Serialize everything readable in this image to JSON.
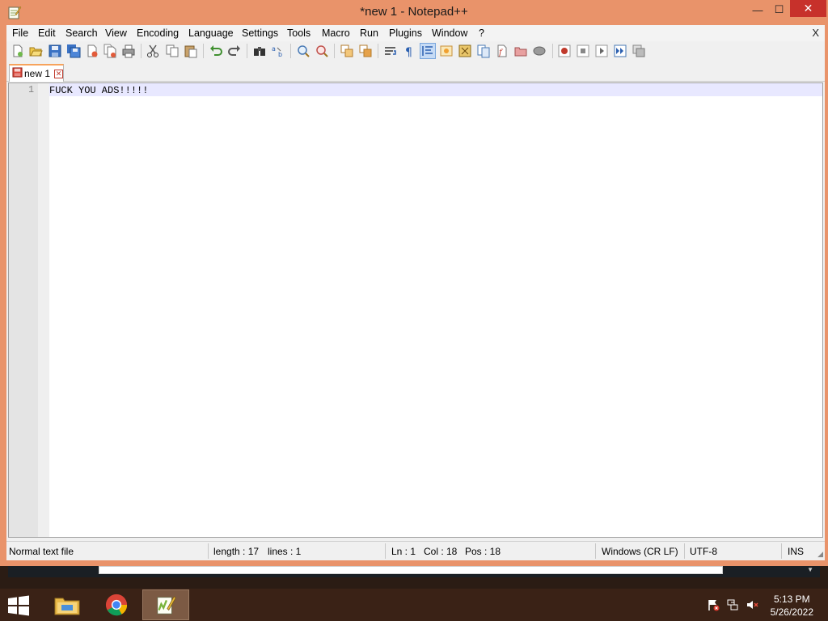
{
  "window": {
    "title": "*new 1 - Notepad++",
    "minimize_glyph": "—",
    "maximize_glyph": "☐",
    "close_glyph": "✕"
  },
  "menu": {
    "items": [
      "File",
      "Edit",
      "Search",
      "View",
      "Encoding",
      "Language",
      "Settings",
      "Tools",
      "Macro",
      "Run",
      "Plugins",
      "Window",
      "?"
    ],
    "close_label": "X"
  },
  "toolbar": {
    "buttons": [
      "new-file-icon",
      "open-file-icon",
      "save-icon",
      "save-all-icon",
      "close-icon",
      "close-all-icon",
      "print-icon",
      "cut-icon",
      "copy-icon",
      "paste-icon",
      "undo-icon",
      "redo-icon",
      "find-icon",
      "replace-icon",
      "zoom-in-icon",
      "zoom-out-icon",
      "sync-vertical-icon",
      "sync-horizontal-icon",
      "word-wrap-icon",
      "show-all-chars-icon",
      "indent-guide-icon",
      "doc-map-icon",
      "function-list-icon",
      "folder-as-workspace-icon",
      "document-list-icon",
      "monitoring-icon",
      "record-macro-icon",
      "stop-macro-icon",
      "play-macro-icon",
      "run-macro-multiple-icon",
      "save-macro-icon"
    ]
  },
  "tabs": [
    {
      "label": "new 1",
      "close_glyph": "✕",
      "icon": "unsaved-file-icon"
    }
  ],
  "editor": {
    "lines": [
      {
        "number": "1",
        "text": "FUCK YOU ADS!!!!!"
      }
    ],
    "colors": {
      "current_line": "#e8e8ff",
      "gutter": "#e4e4e4"
    }
  },
  "statusbar": {
    "file_type": "Normal text file",
    "length": "length : 17",
    "lines": "lines : 1",
    "ln": "Ln : 1",
    "col": "Col : 18",
    "pos": "Pos : 18",
    "eol": "Windows (CR LF)",
    "encoding": "UTF-8",
    "mode": "INS"
  },
  "taskbar": {
    "apps": [
      "file-explorer-icon",
      "chrome-icon",
      "notepad-plus-plus-icon"
    ],
    "active_app": "notepad-plus-plus-icon",
    "tray": [
      "action-center-flag-icon",
      "network-icon",
      "volume-muted-icon"
    ],
    "time": "5:13 PM",
    "date": "5/26/2022"
  },
  "theme": {
    "frame_color": "#e9936a",
    "close_button_color": "#c7312b",
    "taskbar_color": "#3a2216"
  }
}
